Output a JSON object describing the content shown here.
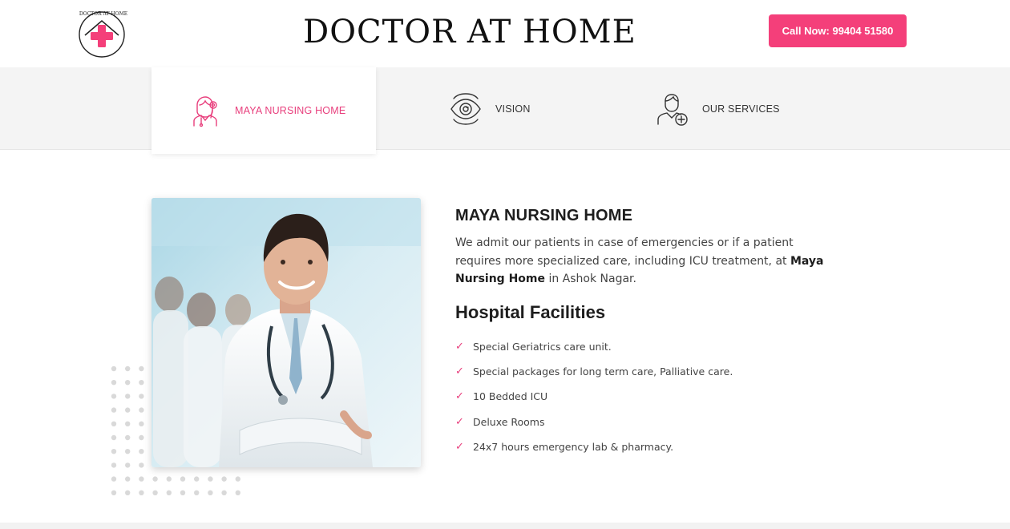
{
  "header": {
    "logo_text": "DOCTOR AT HOME",
    "site_title": "DOCTOR AT HOME",
    "call_button": "Call Now: 99404 51580"
  },
  "tabs": [
    {
      "label": "MAYA NURSING HOME",
      "icon": "nurse-icon",
      "active": true
    },
    {
      "label": "VISION",
      "icon": "eye-icon",
      "active": false
    },
    {
      "label": "OUR SERVICES",
      "icon": "doctor-plus-icon",
      "active": false
    }
  ],
  "content": {
    "title": "MAYA NURSING HOME",
    "desc_part1": "We admit our patients in case of emergencies or if a patient requires more specialized care, including ICU treatment, at ",
    "desc_highlight": "Maya Nursing Home",
    "desc_part2": " in Ashok Nagar.",
    "facilities_title": "Hospital Facilities",
    "facilities": [
      "Special Geriatrics care unit.",
      "Special packages for long term care, Palliative care.",
      "10 Bedded ICU",
      "Deluxe Rooms",
      "24x7 hours emergency lab & pharmacy."
    ]
  },
  "colors": {
    "accent": "#f43f7a",
    "accent_text": "#e83e7c",
    "tabs_bg": "#f4f4f4"
  }
}
